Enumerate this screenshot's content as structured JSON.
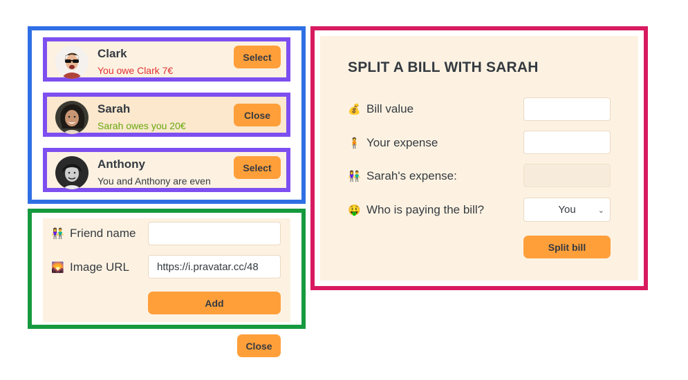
{
  "friends": [
    {
      "name": "Clark",
      "status": "You owe Clark 7€",
      "button": "Select"
    },
    {
      "name": "Sarah",
      "status": "Sarah owes you 20€",
      "button": "Close"
    },
    {
      "name": "Anthony",
      "status": "You and Anthony are even",
      "button": "Select"
    }
  ],
  "add_form": {
    "name_label": "Friend name",
    "name_icon": "👫",
    "name_value": "",
    "image_label": "Image URL",
    "image_icon": "🌄",
    "image_value": "https://i.pravatar.cc/48",
    "add_button": "Add"
  },
  "close_button": "Close",
  "split": {
    "title": "SPLIT A BILL WITH SARAH",
    "bill_icon": "💰",
    "bill_label": "Bill value",
    "bill_value": "",
    "your_icon": "🧍",
    "your_label": "Your expense",
    "your_value": "",
    "friend_icon": "👫",
    "friend_label": "Sarah's expense:",
    "friend_value": "",
    "payer_icon": "🤑",
    "payer_label": "Who is paying the bill?",
    "payer_value": "You",
    "submit": "Split bill"
  },
  "colors": {
    "accent": "#ff9f3a",
    "panel": "#fdf2e2",
    "owe": "#e03131",
    "owed": "#66a80f",
    "frame_list": "#2f6fe4",
    "frame_item": "#7d4ff0",
    "frame_form": "#179a3f",
    "frame_split": "#d81b60"
  }
}
